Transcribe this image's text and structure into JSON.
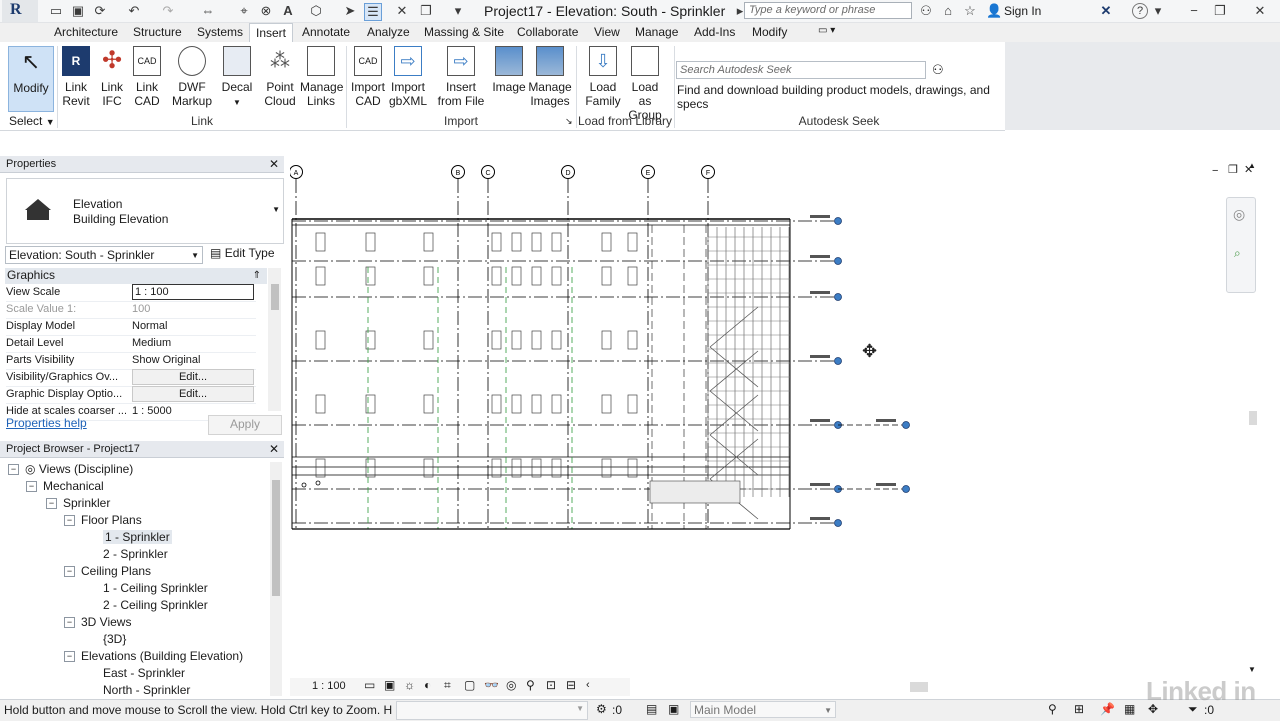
{
  "app": {
    "logo": "R",
    "title": "Project17 - Elevation: South - Sprinkler",
    "search_placeholder": "Type a keyword or phrase",
    "sign_in": "Sign In"
  },
  "icons": {
    "open": "open-icon",
    "save": "save-icon",
    "undo": "undo-icon",
    "redo": "redo-icon",
    "measure": "measure-icon",
    "text": "text-icon",
    "binoculars": "binoculars-icon",
    "star": "star-icon",
    "user": "user-icon",
    "help": "help-icon"
  },
  "tabs": [
    "Architecture",
    "Structure",
    "Systems",
    "Insert",
    "Annotate",
    "Analyze",
    "Massing & Site",
    "Collaborate",
    "View",
    "Manage",
    "Add-Ins",
    "Modify"
  ],
  "active_tab": "Insert",
  "ribbon": {
    "modify": "Modify",
    "select": "Select",
    "link_revit": [
      "Link",
      "Revit"
    ],
    "link_ifc": [
      "Link",
      "IFC"
    ],
    "link_cad": [
      "Link",
      "CAD"
    ],
    "dwf_markup": [
      "DWF",
      "Markup"
    ],
    "decal": "Decal",
    "point_cloud": [
      "Point",
      "Cloud"
    ],
    "manage_links": [
      "Manage",
      "Links"
    ],
    "import_cad": [
      "Import",
      "CAD"
    ],
    "import_gbxml": [
      "Import",
      "gbXML"
    ],
    "insert_from_file": [
      "Insert",
      "from File"
    ],
    "image": "Image",
    "manage_images": [
      "Manage",
      "Images"
    ],
    "load_family": [
      "Load",
      "Family"
    ],
    "load_as_group": [
      "Load as",
      "Group"
    ],
    "seek_placeholder": "Search Autodesk Seek",
    "seek_desc": "Find and download building product models, drawings, and specs",
    "panels": {
      "link": "Link",
      "import": "Import",
      "load_from_library": "Load from Library",
      "autodesk_seek": "Autodesk Seek"
    }
  },
  "properties": {
    "header": "Properties",
    "type_line1": "Elevation",
    "type_line2": "Building Elevation",
    "selector": "Elevation: South - Sprinkler",
    "edit_type": "Edit Type",
    "group": "Graphics",
    "rows": [
      {
        "key": "View Scale",
        "value": "1 : 100"
      },
      {
        "key": "Scale Value    1:",
        "value": "100"
      },
      {
        "key": "Display Model",
        "value": "Normal"
      },
      {
        "key": "Detail Level",
        "value": "Medium"
      },
      {
        "key": "Parts Visibility",
        "value": "Show Original"
      },
      {
        "key": "Visibility/Graphics Ov...",
        "value": "Edit..."
      },
      {
        "key": "Graphic Display Optio...",
        "value": "Edit..."
      },
      {
        "key": "Hide at scales coarser ...",
        "value": "1 : 5000"
      }
    ],
    "help": "Properties help",
    "apply": "Apply"
  },
  "browser": {
    "header": "Project Browser - Project17",
    "items": [
      {
        "label": "Views (Discipline)",
        "level": 0,
        "toggle": "−"
      },
      {
        "label": "Mechanical",
        "level": 1,
        "toggle": "−"
      },
      {
        "label": "Sprinkler",
        "level": 2,
        "toggle": "−"
      },
      {
        "label": "Floor Plans",
        "level": 3,
        "toggle": "−"
      },
      {
        "label": "1 - Sprinkler",
        "level": 4,
        "toggle": ""
      },
      {
        "label": "2 - Sprinkler",
        "level": 4,
        "toggle": ""
      },
      {
        "label": "Ceiling Plans",
        "level": 3,
        "toggle": "−"
      },
      {
        "label": "1 - Ceiling Sprinkler",
        "level": 4,
        "toggle": ""
      },
      {
        "label": "2 - Ceiling Sprinkler",
        "level": 4,
        "toggle": ""
      },
      {
        "label": "3D Views",
        "level": 3,
        "toggle": "−"
      },
      {
        "label": "{3D}",
        "level": 4,
        "toggle": ""
      },
      {
        "label": "Elevations (Building Elevation)",
        "level": 3,
        "toggle": "−"
      },
      {
        "label": "East - Sprinkler",
        "level": 4,
        "toggle": ""
      },
      {
        "label": "North - Sprinkler",
        "level": 4,
        "toggle": ""
      }
    ]
  },
  "drawing": {
    "grids": [
      "A",
      "B",
      "C",
      "D",
      "E",
      "F"
    ],
    "view_scale": "1 : 100"
  },
  "status": {
    "message": "Hold button and move mouse to Scroll the view. Hold Ctrl key to Zoom. H",
    "selection_count": ":0",
    "model": "Main Model",
    "filter_count": ":0"
  },
  "watermark": "Linked in",
  "colors": {
    "accent": "#3c7dc4",
    "grid": "#000000",
    "hidden": "#2e9a3a"
  }
}
